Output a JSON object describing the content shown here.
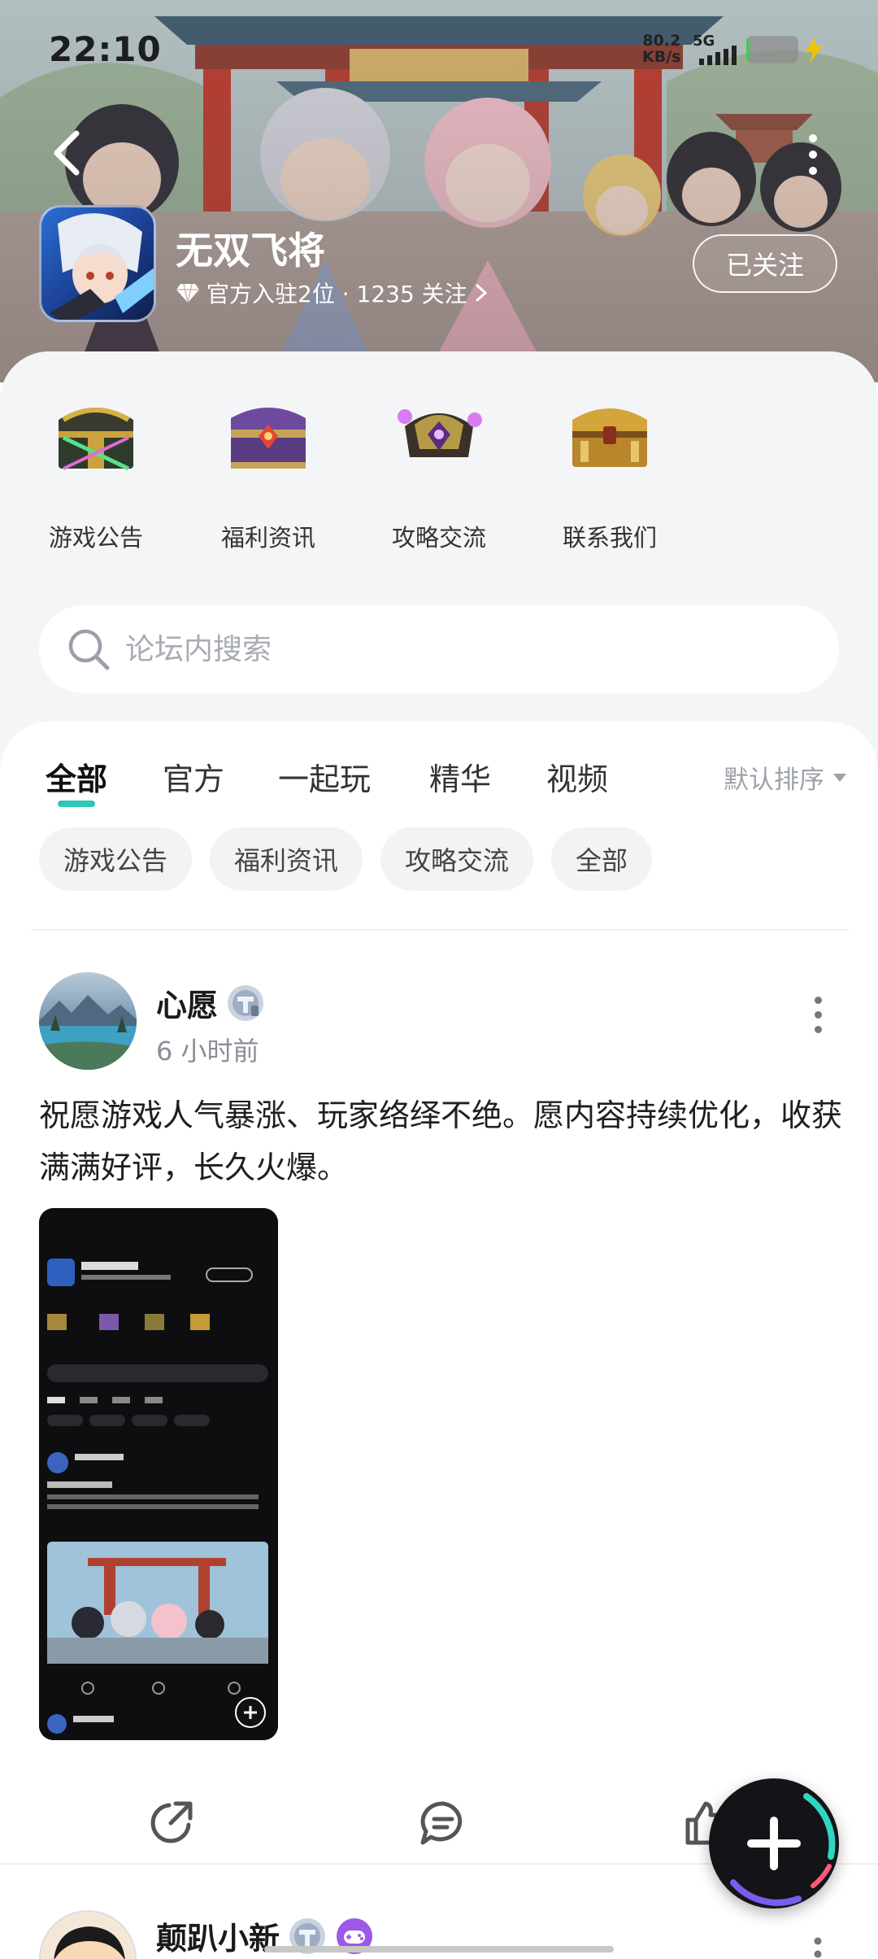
{
  "status_bar": {
    "time": "22:10",
    "net_speed_value": "80.2",
    "net_speed_unit": "KB/s",
    "network": "5G",
    "battery_level": 0.05,
    "battery_color": "#36d24a"
  },
  "header": {
    "game_title": "无双飞将",
    "subtitle": "官方入驻2位 · 1235 关注",
    "follow_label": "已关注",
    "back_icon": "chevron-left-icon",
    "more_icon": "more-vertical-icon",
    "verified_icon": "diamond-icon"
  },
  "quick_links": [
    {
      "label": "游戏公告",
      "icon": "green-chest-icon"
    },
    {
      "label": "福利资讯",
      "icon": "purple-chest-icon"
    },
    {
      "label": "攻略交流",
      "icon": "dark-chest-icon"
    },
    {
      "label": "联系我们",
      "icon": "gold-chest-icon"
    }
  ],
  "search": {
    "placeholder": "论坛内搜索"
  },
  "tabs": {
    "items": [
      "全部",
      "官方",
      "一起玩",
      "精华",
      "视频"
    ],
    "active": "全部",
    "sort_label": "默认排序",
    "accent": "#2fc6b7"
  },
  "chips": [
    "游戏公告",
    "福利资讯",
    "攻略交流",
    "全部"
  ],
  "post": {
    "username": "心愿",
    "time": "6 小时前",
    "text": "祝愿游戏人气暴涨、玩家络绎不绝。愿内容持续优化，收获满满好评，长久火爆。",
    "actions": [
      "share-icon",
      "comment-icon",
      "like-icon"
    ]
  },
  "post2": {
    "username": "颠趴小新"
  },
  "fab": {
    "icon": "plus-icon"
  }
}
